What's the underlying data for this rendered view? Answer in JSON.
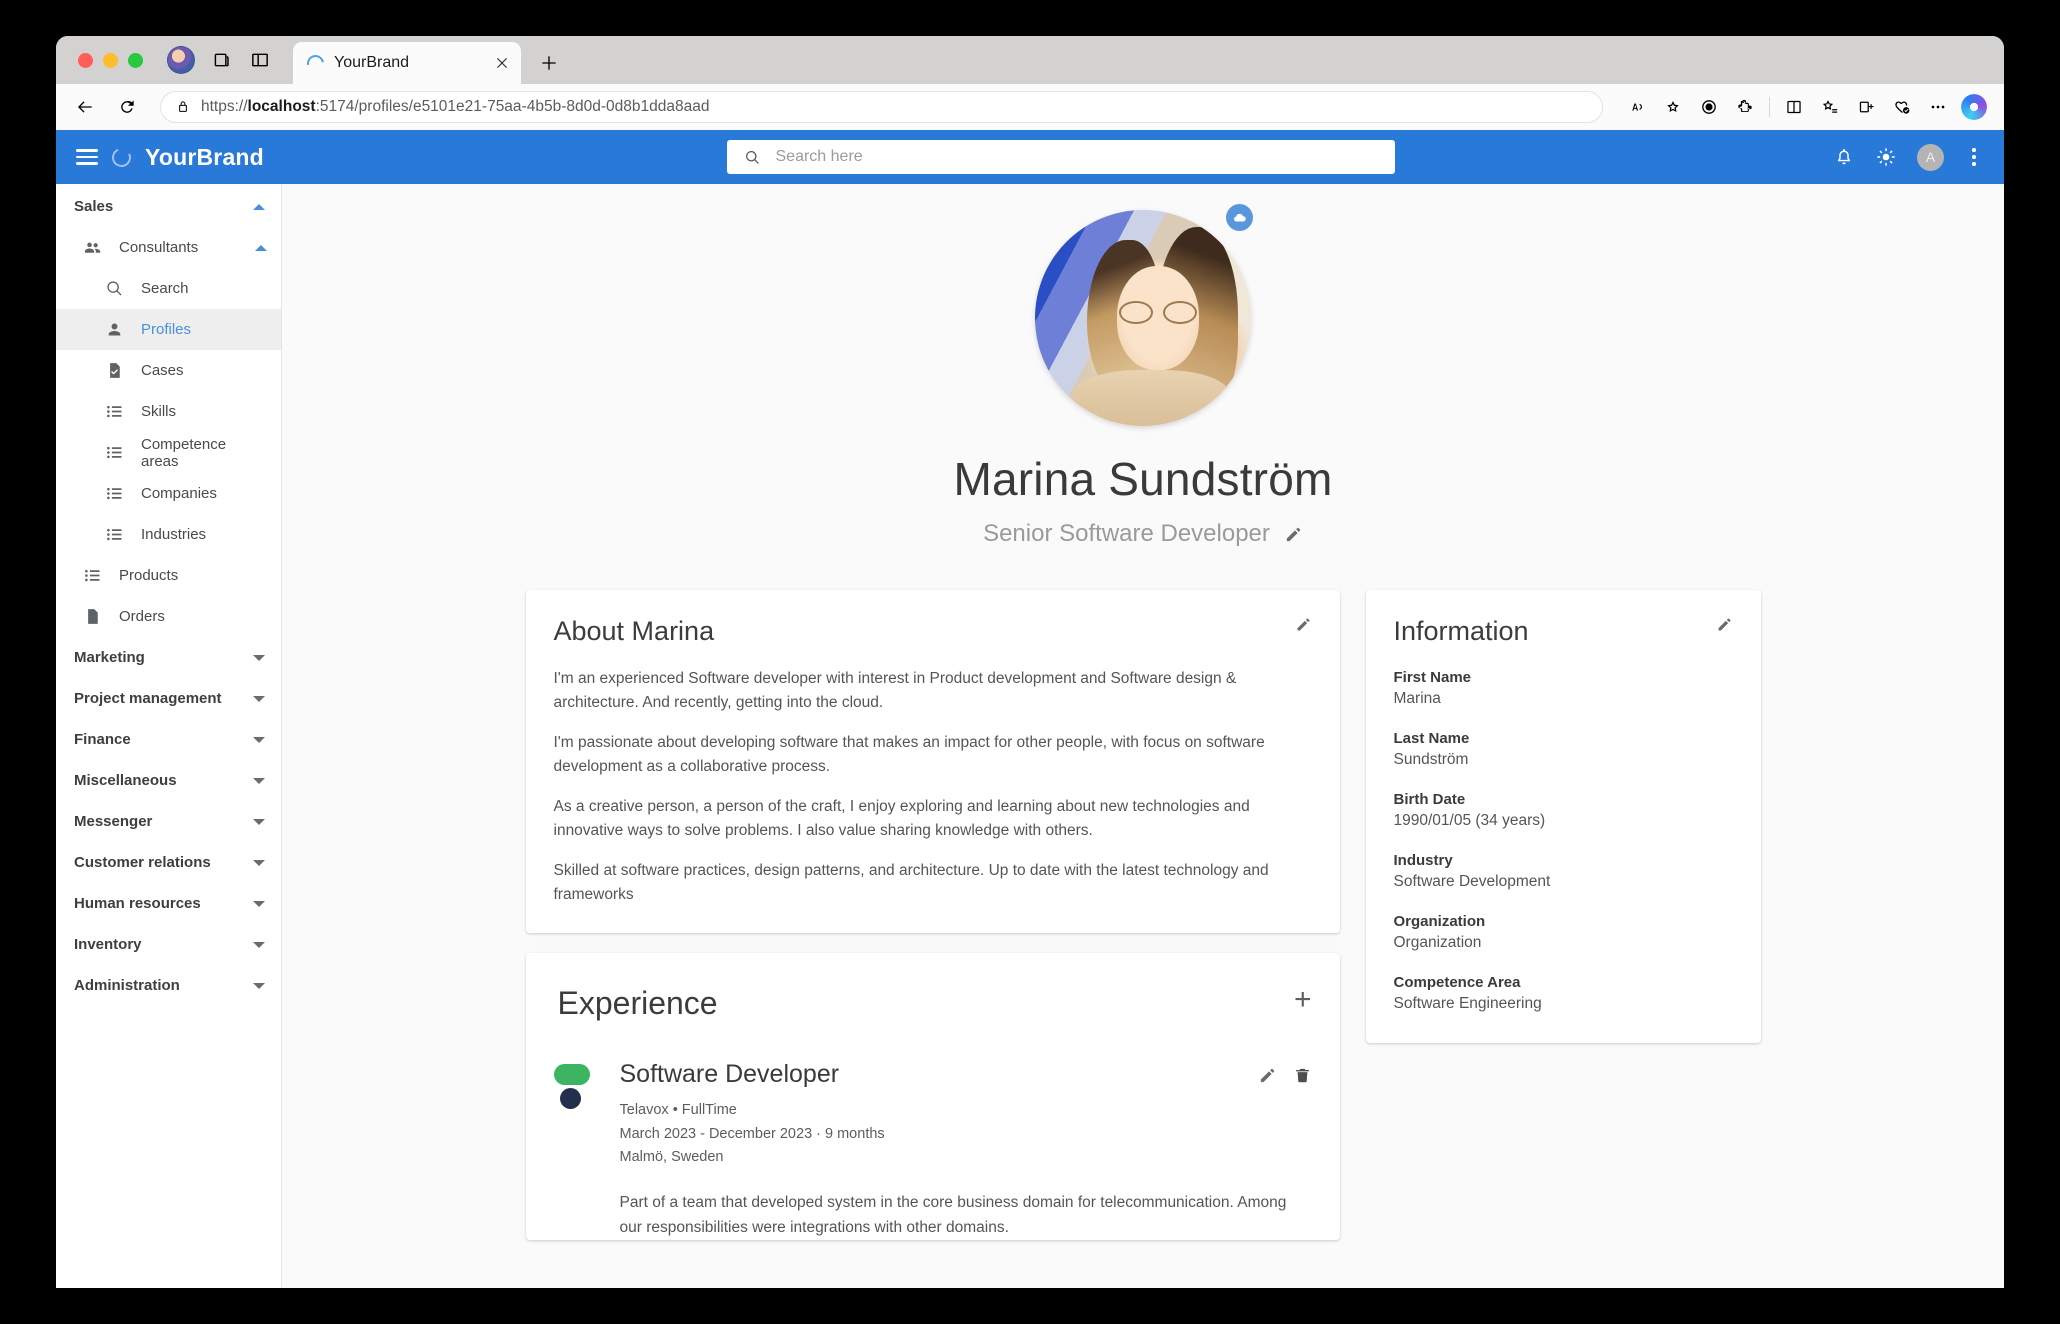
{
  "browser": {
    "tab": {
      "title": "YourBrand",
      "icon": "loading-spinner-icon",
      "close_label": "×"
    },
    "new_tab_label": "+",
    "url_protocol": "https://",
    "url_host": "localhost",
    "url_rest": ":5174/profiles/e5101e21-75aa-4b5b-8d0d-0d8b1dda8aad",
    "url_full": "https://localhost:5174/profiles/e5101e21-75aa-4b5b-8d0d-0d8b1dda8aad",
    "toolbar_icons": [
      "back-icon",
      "refresh-icon",
      "lock-icon",
      "read-aloud-icon",
      "favorite-star-icon",
      "tracking-prevention-icon",
      "extensions-icon",
      "split-screen-icon",
      "collections-icon",
      "tab-actions-icon",
      "browser-essentials-icon",
      "settings-ellipsis-icon",
      "copilot-icon"
    ],
    "tabstrip_icons": [
      "profile-avatar-icon",
      "workspaces-icon",
      "tab-list-icon"
    ]
  },
  "appbar": {
    "menu_icon": "hamburger-menu-icon",
    "logo_icon": "brand-ring-icon",
    "brand": "YourBrand",
    "search": {
      "placeholder": "Search here",
      "value": "",
      "icon": "search-icon"
    },
    "notifications_icon": "bell-icon",
    "theme_icon": "sun-icon",
    "avatar_initial": "A",
    "overflow_icon": "kebab-menu-icon",
    "background": "#2979d8"
  },
  "sidebar": {
    "groups": [
      {
        "label": "Sales",
        "expanded": true,
        "items": [
          {
            "label": "Consultants",
            "icon": "people-icon",
            "level": 2,
            "expanded": true,
            "active": false
          },
          {
            "label": "Search",
            "icon": "search-icon",
            "level": 3,
            "active": false
          },
          {
            "label": "Profiles",
            "icon": "person-icon",
            "level": 3,
            "active": true
          },
          {
            "label": "Cases",
            "icon": "document-check-icon",
            "level": 3,
            "active": false
          },
          {
            "label": "Skills",
            "icon": "list-icon",
            "level": 3,
            "active": false
          },
          {
            "label": "Competence areas",
            "icon": "list-icon",
            "level": 3,
            "active": false
          },
          {
            "label": "Companies",
            "icon": "list-icon",
            "level": 3,
            "active": false
          },
          {
            "label": "Industries",
            "icon": "list-icon",
            "level": 3,
            "active": false
          },
          {
            "label": "Products",
            "icon": "list-icon",
            "level": 2,
            "active": false
          },
          {
            "label": "Orders",
            "icon": "file-icon",
            "level": 2,
            "active": false
          }
        ]
      },
      {
        "label": "Marketing",
        "expanded": false,
        "items": []
      },
      {
        "label": "Project management",
        "expanded": false,
        "items": []
      },
      {
        "label": "Finance",
        "expanded": false,
        "items": []
      },
      {
        "label": "Miscellaneous",
        "expanded": false,
        "items": []
      },
      {
        "label": "Messenger",
        "expanded": false,
        "items": []
      },
      {
        "label": "Customer relations",
        "expanded": false,
        "items": []
      },
      {
        "label": "Human resources",
        "expanded": false,
        "items": []
      },
      {
        "label": "Inventory",
        "expanded": false,
        "items": []
      },
      {
        "label": "Administration",
        "expanded": false,
        "items": []
      }
    ],
    "active_item_color": "#4a90d9",
    "active_item_background": "#eeeeee"
  },
  "profile": {
    "photo_alt": "Marina Sundström profile photo",
    "upload_icon": "cloud-upload-icon",
    "name": "Marina Sundström",
    "title": "Senior Software Developer",
    "title_edit_icon": "pencil-icon"
  },
  "about": {
    "title": "About Marina",
    "edit_icon": "pencil-icon",
    "paragraphs": [
      "I'm an experienced Software developer with interest in Product development and Software design & architecture. And recently, getting into the cloud.",
      "I'm passionate about developing software that makes an impact for other people, with focus on software development as a collaborative process.",
      "As a creative person, a person of the craft, I enjoy exploring and learning about new technologies and innovative ways to solve problems. I also value sharing knowledge with others.",
      "Skilled at software practices, design patterns, and architecture. Up to date with the latest technology and frameworks"
    ]
  },
  "information": {
    "title": "Information",
    "edit_icon": "pencil-icon",
    "fields": [
      {
        "label": "First Name",
        "value": "Marina"
      },
      {
        "label": "Last Name",
        "value": "Sundström"
      },
      {
        "label": "Birth Date",
        "value": "1990/01/05 (34 years)"
      },
      {
        "label": "Industry",
        "value": "Software Development"
      },
      {
        "label": "Organization",
        "value": "Organization"
      },
      {
        "label": "Competence Area",
        "value": "Software Engineering"
      }
    ]
  },
  "experience": {
    "title": "Experience",
    "add_label": "+",
    "items": [
      {
        "logo_icon": "telavox-logo-icon",
        "logo_colors": {
          "bar": "#3cb462",
          "dot": "#22304e"
        },
        "role": "Software Developer",
        "company_employment": "Telavox • FullTime",
        "dates": "March 2023 - December 2023 · 9 months",
        "location": "Malmö, Sweden",
        "description": "Part of a team that developed system in the core business domain for telecommunication. Among our responsibilities were integrations with other domains.",
        "edit_icon": "pencil-icon",
        "delete_icon": "trash-icon"
      }
    ]
  }
}
